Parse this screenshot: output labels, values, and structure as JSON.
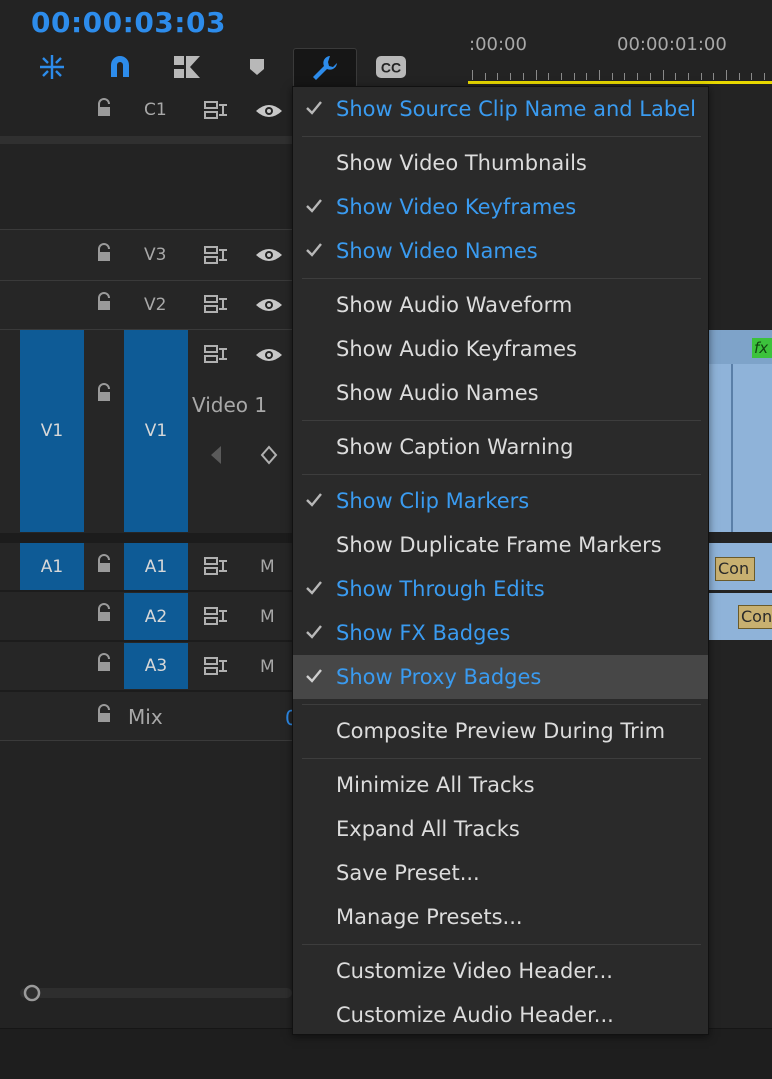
{
  "header": {
    "timecode": "00:00:03:03",
    "ruler_labels": [
      ":00:00",
      "00:00:01:00"
    ],
    "accent_color": "#2d8ceb",
    "playhead_bar_color": "#e8d800"
  },
  "toolbar": {
    "icons": [
      "ripple-snap-icon",
      "magnet-icon",
      "linked-selection-icon",
      "marker-icon",
      "wrench-icon",
      "closed-captions-icon"
    ],
    "cc_label": "CC"
  },
  "tracks": {
    "caption": {
      "name": "C1"
    },
    "video": [
      {
        "name": "V3"
      },
      {
        "name": "V2"
      },
      {
        "source": "V1",
        "name": "V1",
        "title": "Video 1"
      }
    ],
    "audio": [
      {
        "source": "A1",
        "name": "A1",
        "mute": "M"
      },
      {
        "name": "A2",
        "mute": "M"
      },
      {
        "name": "A3",
        "mute": "M"
      }
    ],
    "mix": {
      "name": "Mix",
      "partial_value": "0"
    }
  },
  "clips": {
    "fx_badge": "fx",
    "clip1_label": "Con",
    "clip2_label": "Con"
  },
  "menu": {
    "items": [
      {
        "label": "Show Source Clip Name and Label",
        "checked": true
      },
      {
        "label": "Show Video Thumbnails",
        "checked": false
      },
      {
        "label": "Show Video Keyframes",
        "checked": true
      },
      {
        "label": "Show Video Names",
        "checked": true
      },
      {
        "label": "Show Audio Waveform",
        "checked": false
      },
      {
        "label": "Show Audio Keyframes",
        "checked": false
      },
      {
        "label": "Show Audio Names",
        "checked": false
      },
      {
        "label": "Show Caption Warning",
        "checked": false
      },
      {
        "label": "Show Clip Markers",
        "checked": true
      },
      {
        "label": "Show Duplicate Frame Markers",
        "checked": false
      },
      {
        "label": "Show Through Edits",
        "checked": true
      },
      {
        "label": "Show FX Badges",
        "checked": true
      },
      {
        "label": "Show Proxy Badges",
        "checked": true,
        "highlighted": true
      },
      {
        "label": "Composite Preview During Trim",
        "checked": false
      },
      {
        "label": "Minimize All Tracks",
        "checked": false
      },
      {
        "label": "Expand All Tracks",
        "checked": false
      },
      {
        "label": "Save Preset...",
        "checked": false
      },
      {
        "label": "Manage Presets...",
        "checked": false
      },
      {
        "label": "Customize Video Header...",
        "checked": false
      },
      {
        "label": "Customize Audio Header...",
        "checked": false
      }
    ],
    "check_color": "#3a9bf0",
    "highlight_color": "#474747"
  }
}
